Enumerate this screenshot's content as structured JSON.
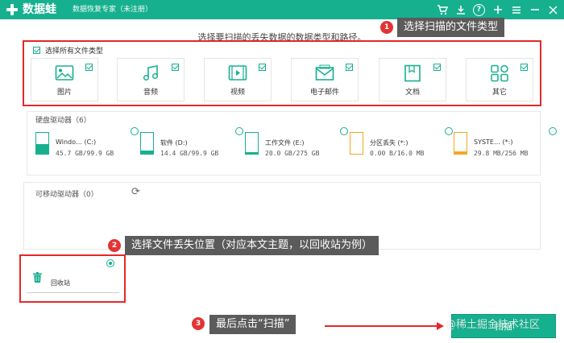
{
  "app": {
    "title": "数据蛙",
    "subtitle": "数据恢复专家（未注册）"
  },
  "titlebar": {
    "icons": [
      "cart-icon",
      "download-icon",
      "help-icon",
      "plus-icon",
      "menu-icon",
      "minimize-icon",
      "close-icon"
    ]
  },
  "instruction": "选择要扫描的丢失数据的数据类型和路径。",
  "filetypes": {
    "select_all_label": "选择所有文件类型",
    "items": [
      {
        "label": "图片",
        "icon": "image-icon",
        "checked": true
      },
      {
        "label": "音频",
        "icon": "music-icon",
        "checked": true
      },
      {
        "label": "视频",
        "icon": "video-icon",
        "checked": true
      },
      {
        "label": "电子邮件",
        "icon": "mail-icon",
        "checked": true
      },
      {
        "label": "文档",
        "icon": "document-icon",
        "checked": true
      },
      {
        "label": "其它",
        "icon": "other-icon",
        "checked": true
      }
    ]
  },
  "harddrives": {
    "title": "硬盘驱动器（6）",
    "items": [
      {
        "name": "Windo… (C:)",
        "size": "45.7 GB/99.9 GB",
        "used_fraction": 0.46,
        "color": "#16b08f"
      },
      {
        "name": "软件 (D:)",
        "size": "14.4 GB/99.9 GB",
        "used_fraction": 0.14,
        "color": "#16b08f"
      },
      {
        "name": "工作文件 (E:)",
        "size": "20.0 GB/275 GB",
        "used_fraction": 0.07,
        "color": "#16b08f"
      },
      {
        "name": "分区丢失 (*:)",
        "size": "0.00 B/16.0 MB",
        "used_fraction": 0.0,
        "color": "#f5a623"
      },
      {
        "name": "SYSTE… (*:)",
        "size": "29.8 MB/256 MB",
        "used_fraction": 0.12,
        "color": "#f5a623"
      }
    ]
  },
  "removable": {
    "title": "可移动驱动器（0）"
  },
  "recycle_bin": {
    "label": "回收站"
  },
  "annotations": {
    "step1": {
      "num": "1",
      "text": "选择扫描的文件类型"
    },
    "step2": {
      "num": "2",
      "text": "选择文件丢失位置（对应本文主题，以回收站为例）"
    },
    "step3": {
      "num": "3",
      "text": "最后点击“扫描”"
    }
  },
  "scan_button": {
    "label": "扫描"
  },
  "watermark": "@稀土掘金技术社区",
  "colors": {
    "accent": "#16b08f",
    "annotation": "#e32828",
    "warning": "#f5a623"
  }
}
